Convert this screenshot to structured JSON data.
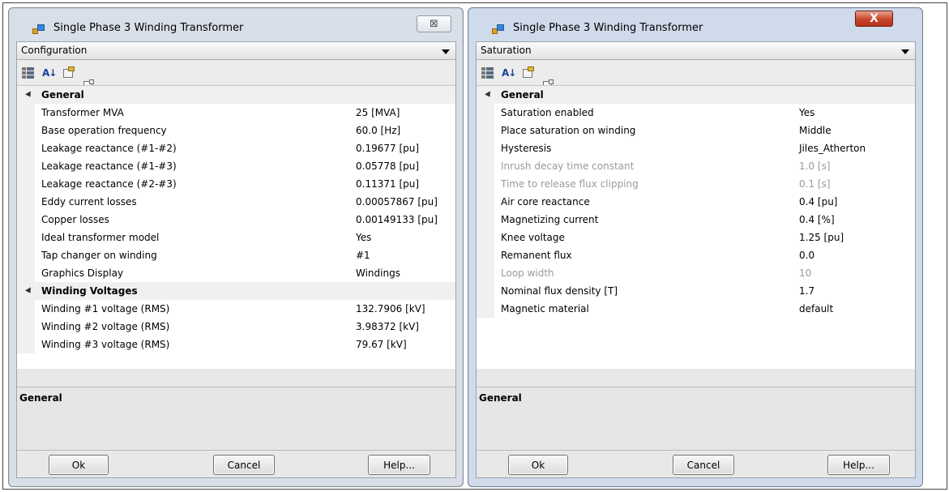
{
  "dialogs": [
    {
      "title": "Single Phase 3 Winding Transformer",
      "close_glyph": "⊠",
      "combo_value": "Configuration",
      "categories": [
        {
          "label": "General",
          "props": [
            {
              "name": "Transformer MVA",
              "value": "25 [MVA]"
            },
            {
              "name": "Base operation frequency",
              "value": "60.0 [Hz]"
            },
            {
              "name": "Leakage reactance (#1-#2)",
              "value": "0.19677 [pu]"
            },
            {
              "name": "Leakage reactance (#1-#3)",
              "value": "0.05778 [pu]"
            },
            {
              "name": "Leakage reactance (#2-#3)",
              "value": "0.11371 [pu]"
            },
            {
              "name": "Eddy current losses",
              "value": "0.00057867 [pu]"
            },
            {
              "name": "Copper losses",
              "value": "0.00149133 [pu]"
            },
            {
              "name": "Ideal transformer model",
              "value": "Yes"
            },
            {
              "name": "Tap changer on winding",
              "value": "#1"
            },
            {
              "name": "Graphics Display",
              "value": "Windings"
            }
          ]
        },
        {
          "label": "Winding Voltages",
          "props": [
            {
              "name": "Winding #1 voltage (RMS)",
              "value": "132.7906 [kV]"
            },
            {
              "name": "Winding #2 voltage (RMS)",
              "value": "3.98372 [kV]"
            },
            {
              "name": "Winding #3 voltage (RMS)",
              "value": "79.67 [kV]"
            }
          ]
        }
      ],
      "help_title": "General",
      "buttons": {
        "ok": "Ok",
        "cancel": "Cancel",
        "help": "Help..."
      }
    },
    {
      "title": "Single Phase 3 Winding Transformer",
      "close_glyph": "X",
      "combo_value": "Saturation",
      "categories": [
        {
          "label": "General",
          "props": [
            {
              "name": "Saturation enabled",
              "value": "Yes"
            },
            {
              "name": "Place saturation on winding",
              "value": "Middle"
            },
            {
              "name": "Hysteresis",
              "value": "Jiles_Atherton"
            },
            {
              "name": "Inrush decay time constant",
              "value": "1.0 [s]",
              "disabled": true
            },
            {
              "name": "Time to release flux clipping",
              "value": "0.1 [s]",
              "disabled": true
            },
            {
              "name": "Air core reactance",
              "value": "0.4 [pu]"
            },
            {
              "name": "Magnetizing current",
              "value": "0.4 [%]"
            },
            {
              "name": "Knee voltage",
              "value": "1.25 [pu]"
            },
            {
              "name": "Remanent flux",
              "value": "0.0"
            },
            {
              "name": "Loop width",
              "value": "10",
              "disabled": true
            },
            {
              "name": "Nominal flux density [T]",
              "value": "1.7"
            },
            {
              "name": "Magnetic material",
              "value": "default"
            }
          ]
        }
      ],
      "help_title": "General",
      "buttons": {
        "ok": "Ok",
        "cancel": "Cancel",
        "help": "Help..."
      }
    }
  ],
  "toolbar_icons": [
    "categorized-icon",
    "alphabetical-sort-icon",
    "property-pages-icon",
    "page-icon"
  ],
  "colors": {
    "dialog_frame": "#d8dfe9",
    "active_close_button": "#c8452b",
    "category_row": "#f0f0f0",
    "disabled_text": "#9a9a9a"
  }
}
